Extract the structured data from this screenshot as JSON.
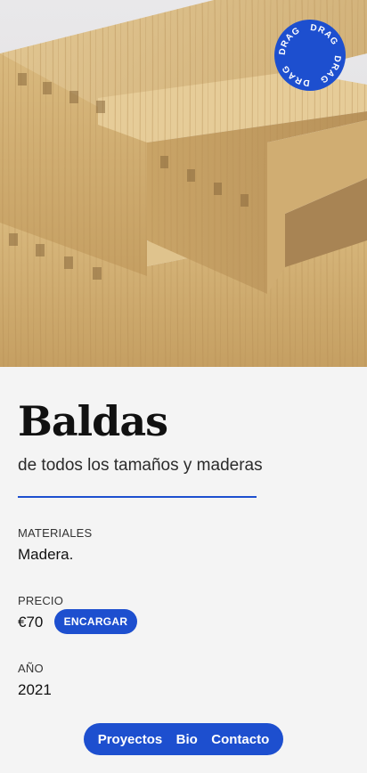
{
  "hero": {
    "badge_text": "DRAG",
    "badge_color": "#1d4fcf"
  },
  "product": {
    "title": "Baldas",
    "subtitle": "de todos los tamaños y maderas"
  },
  "details": {
    "materials_label": "MATERIALES",
    "materials_value": "Madera.",
    "price_label": "PRECIO",
    "price_value": "€70",
    "order_label": "ENCARGAR",
    "year_label": "AÑO",
    "year_value": "2021"
  },
  "nav": {
    "items": [
      {
        "label": "Proyectos"
      },
      {
        "label": "Bio"
      },
      {
        "label": "Contacto"
      }
    ]
  },
  "colors": {
    "accent": "#1d4fcf",
    "background": "#f4f4f4"
  }
}
